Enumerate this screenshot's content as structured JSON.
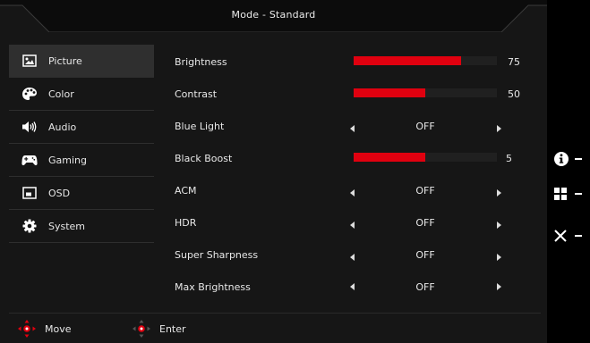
{
  "title": "Mode - Standard",
  "sidebar": {
    "items": [
      {
        "label": "Picture",
        "icon": "picture-icon",
        "active": true
      },
      {
        "label": "Color",
        "icon": "palette-icon",
        "active": false
      },
      {
        "label": "Audio",
        "icon": "speaker-icon",
        "active": false
      },
      {
        "label": "Gaming",
        "icon": "gamepad-icon",
        "active": false
      },
      {
        "label": "OSD",
        "icon": "osd-icon",
        "active": false
      },
      {
        "label": "System",
        "icon": "gear-icon",
        "active": false
      }
    ]
  },
  "settings": {
    "brightness": {
      "label": "Brightness",
      "value": "75",
      "level": 75
    },
    "contrast": {
      "label": "Contrast",
      "value": "50",
      "level": 50
    },
    "blue_light": {
      "label": "Blue Light",
      "value": "OFF"
    },
    "black_boost": {
      "label": "Black Boost",
      "value": "5",
      "level": 50
    },
    "acm": {
      "label": "ACM",
      "value": "OFF"
    },
    "hdr": {
      "label": "HDR",
      "value": "OFF"
    },
    "super_sharpness": {
      "label": "Super Sharpness",
      "value": "OFF"
    },
    "max_brightness": {
      "label": "Max Brightness",
      "value": "OFF"
    }
  },
  "footer": {
    "move_label": "Move",
    "enter_label": "Enter"
  },
  "side_keys": [
    {
      "icon": "info-icon"
    },
    {
      "icon": "grid-icon"
    },
    {
      "icon": "close-icon"
    }
  ],
  "colors": {
    "accent": "#e0000f",
    "background": "#161616",
    "active_item": "#2f2f2f"
  }
}
